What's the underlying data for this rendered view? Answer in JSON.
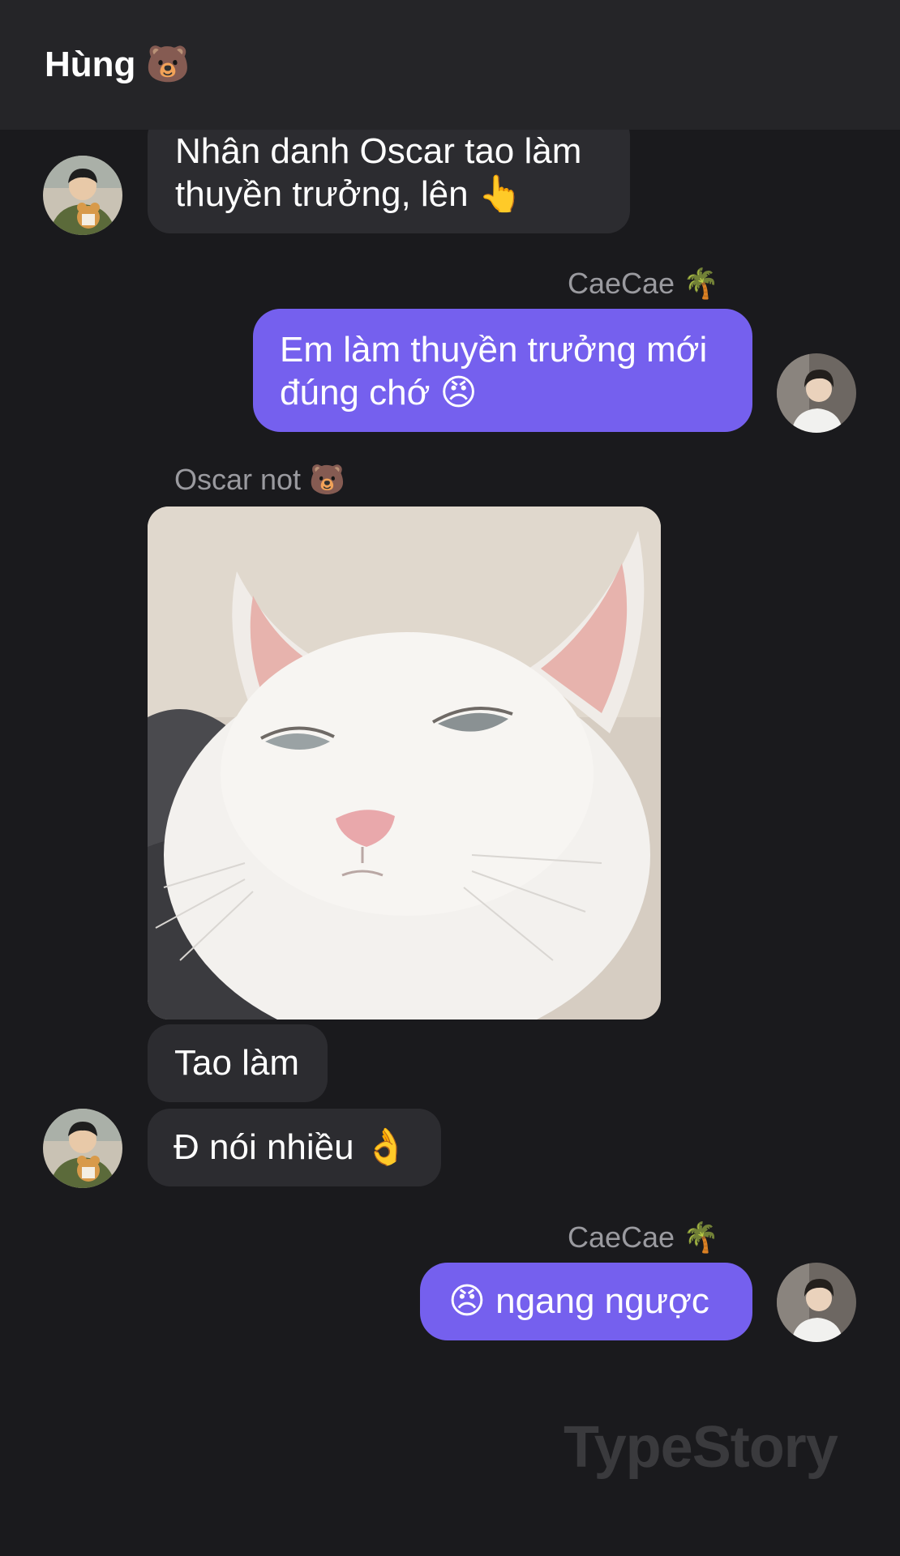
{
  "header": {
    "title": "Hùng 🐻"
  },
  "messages": {
    "m1_text": "Nhân danh Oscar tao làm thuyền trưởng, lên 👆",
    "m2_sender": "CaeCae 🌴",
    "m2_text": "Em làm thuyền trưởng mới đúng chớ 😠",
    "m3_sender": "Oscar not 🐻",
    "m4_text": "Tao làm",
    "m5_text": "Đ nói nhiều 👌",
    "m6_sender": "CaeCae 🌴",
    "m6_text": "😠 ngang ngược"
  },
  "photo": {
    "subject": "grumpy white cat"
  },
  "watermark": {
    "text": "TypeStory"
  },
  "icons": {
    "incoming_avatar": "avatar-hung-icon",
    "outgoing_avatar": "avatar-caecae-icon"
  },
  "colors": {
    "background": "#1a1a1d",
    "header": "#252528",
    "incoming_bubble": "#2c2c30",
    "outgoing_bubble": "#7560ee",
    "sender_name": "#9a9a9f"
  }
}
